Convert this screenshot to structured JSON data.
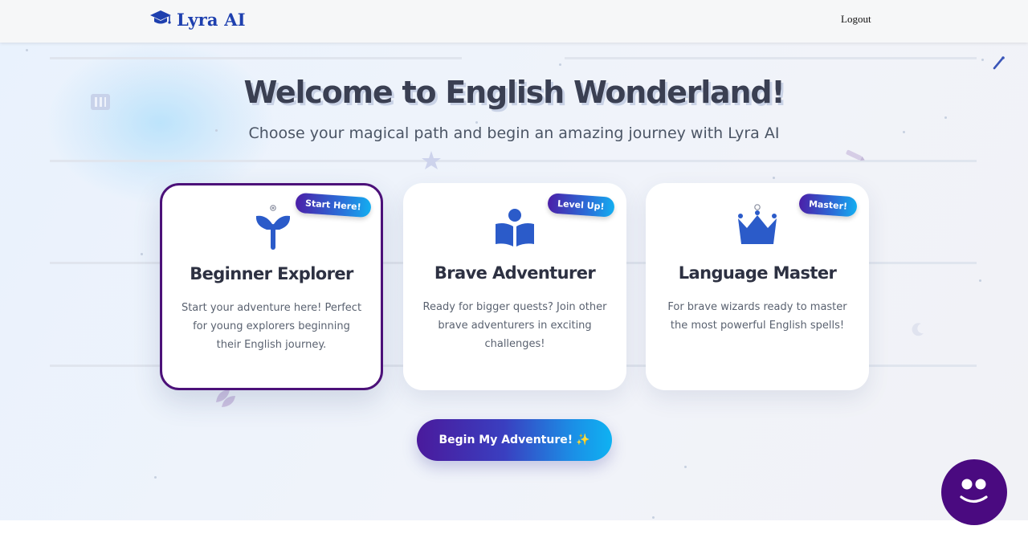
{
  "header": {
    "brand_icon": "graduation-cap-icon",
    "brand_name": "Lyra AI",
    "logout_label": "Logout"
  },
  "hero": {
    "title": "Welcome to English Wonderland!",
    "subtitle": "Choose your magical path and begin an amazing journey with Lyra AI"
  },
  "levels": [
    {
      "badge": "Start Here!",
      "icon": "sprout-icon",
      "title": "Beginner Explorer",
      "description": "Start your adventure here! Perfect for young explorers beginning their English journey.",
      "selected": true
    },
    {
      "badge": "Level Up!",
      "icon": "reader-book-icon",
      "title": "Brave Adventurer",
      "description": "Ready for bigger quests? Join other brave adventurers in exciting challenges!",
      "selected": false
    },
    {
      "badge": "Master!",
      "icon": "crown-icon",
      "title": "Language Master",
      "description": "For brave wizards ready to master the most powerful English spells!",
      "selected": false
    }
  ],
  "cta": {
    "label": "Begin My Adventure!",
    "sparkle": "✨"
  },
  "mascot": {
    "icon": "smiley-face-icon"
  },
  "colors": {
    "brand": "#1e40af",
    "selected_border": "#4c1179",
    "gradient_start": "#4a1a9c",
    "gradient_end": "#0fb2f2",
    "mascot": "#4a0a80"
  }
}
